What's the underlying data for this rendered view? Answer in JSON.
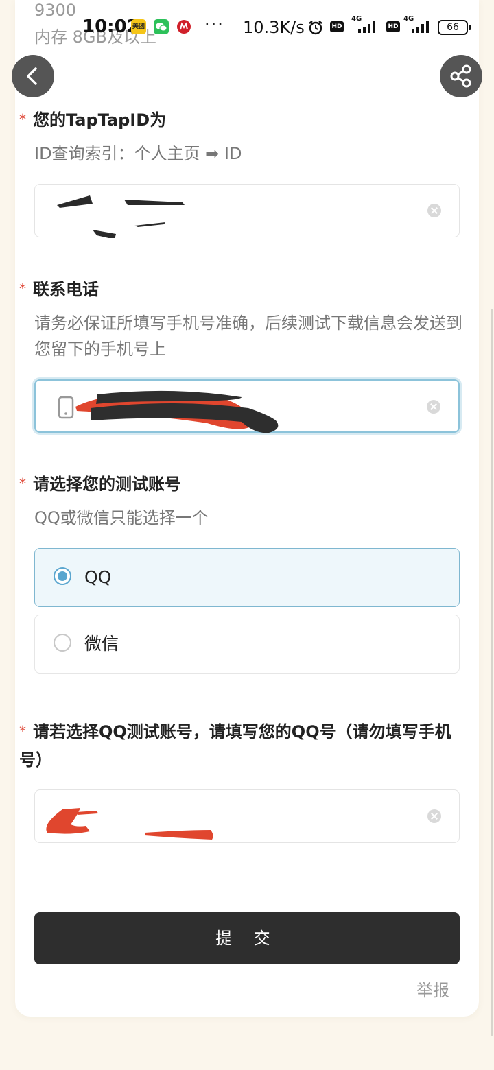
{
  "ghost": {
    "line1": "9300",
    "line2": "内存 8GB及以上"
  },
  "status_bar": {
    "time": "10:02",
    "app_meituan": "美团",
    "dots": "···",
    "net_speed": "10.3K/s",
    "hd1": "HD",
    "net1": "4G",
    "hd2": "HD",
    "net2": "4G",
    "battery": "66"
  },
  "nav": {
    "back_icon": "chevron-left-icon",
    "share_icon": "share-icon"
  },
  "form": {
    "required_mark": "*",
    "taptap": {
      "label": "您的TapTapID为",
      "hint": "ID查询索引：个人主页 ➡ ID"
    },
    "phone": {
      "label": "联系电话",
      "hint": "请务必保证所填写手机号准确，后续测试下载信息会发送到您留下的手机号上"
    },
    "account": {
      "label": "请选择您的测试账号",
      "hint": "QQ或微信只能选择一个",
      "options": [
        {
          "label": "QQ",
          "selected": true
        },
        {
          "label": "微信",
          "selected": false
        }
      ]
    },
    "qq": {
      "label": "请若选择QQ测试账号，请填写您的QQ号（请勿填写手机号）"
    },
    "submit_label": "提 交",
    "report_label": "举报"
  },
  "colors": {
    "page_bg": "#fbf6ec",
    "required": "#e04a3a",
    "accent": "#5aa6cf",
    "button_bg": "#2e2e2e"
  }
}
